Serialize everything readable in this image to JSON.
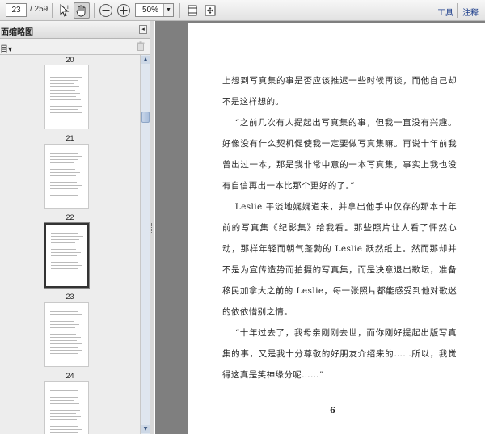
{
  "toolbar": {
    "page_number": "23",
    "page_total": "/ 259",
    "zoom_value": "50%",
    "tools_label": "工具",
    "comment_label": "注释"
  },
  "sidebar": {
    "title": "面缩略图",
    "options_label": "目▾",
    "thumbnails": [
      {
        "label": "20"
      },
      {
        "label": "21"
      },
      {
        "label": "22"
      },
      {
        "label": "23"
      },
      {
        "label": "24"
      }
    ]
  },
  "document": {
    "paragraphs": [
      "上想到写真集的事是否应该推迟一些时候再谈，而他自己却不是这样想的。",
      "“之前几次有人提起出写真集的事，但我一直没有兴趣。好像没有什么契机促使我一定要做写真集嘛。再说十年前我曾出过一本，那是我非常中意的一本写真集，事实上我也没有自信再出一本比那个更好的了。”",
      "Leslie 平淡地娓娓道来，并拿出他手中仅存的那本十年前的写真集《纪影集》给我看。那些照片让人看了怦然心动，那样年轻而朝气蓬勃的 Leslie 跃然纸上。然而那却并不是为宣传造势而拍摄的写真集，而是决意退出歌坛，准备移民加拿大之前的 Leslie，每一张照片都能感受到他对歌迷的依依惜别之情。",
      "“十年过去了，我母亲刚刚去世，而你刚好提起出版写真集的事，又是我十分尊敬的好朋友介绍来的……所以，我觉得这真是笑神缘分呢……”"
    ],
    "page_number": "6"
  }
}
